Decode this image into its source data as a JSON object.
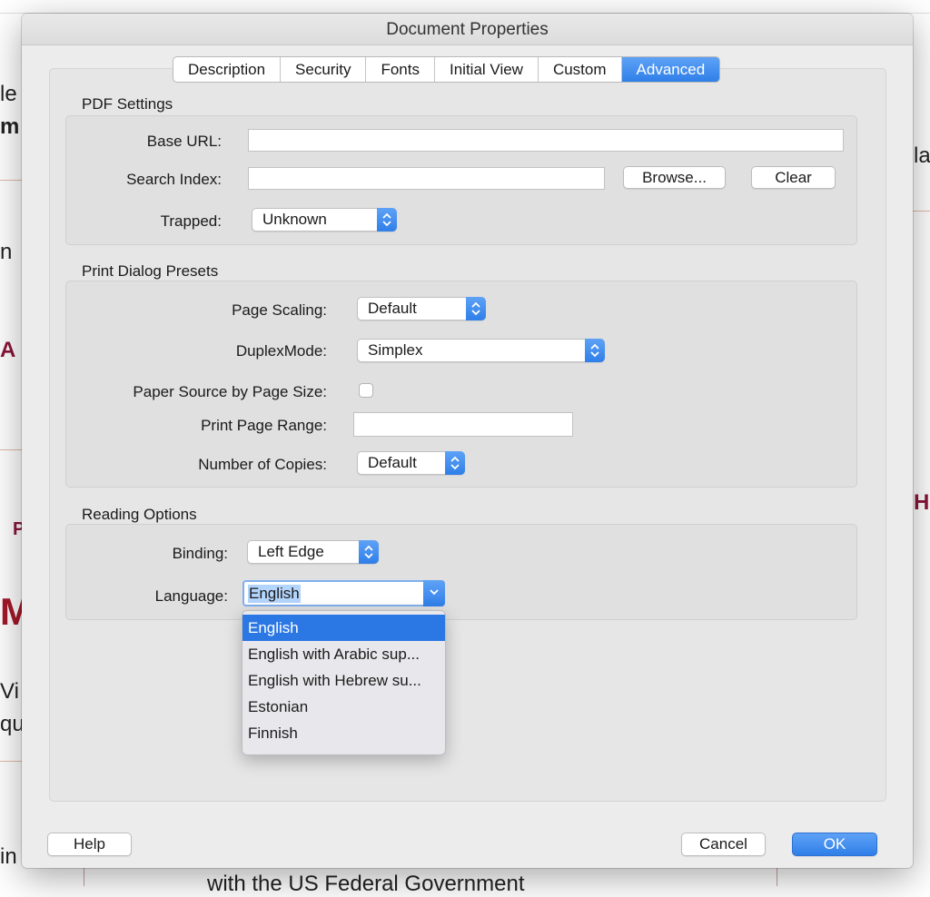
{
  "background": {
    "fragments": [
      "le",
      "m",
      "la",
      "n",
      "A",
      "H",
      "P",
      "Mi",
      "Vi",
      "qua",
      "in",
      "with the US Federal Government"
    ]
  },
  "dialog": {
    "title": "Document Properties",
    "tabs": [
      {
        "label": "Description",
        "active": false
      },
      {
        "label": "Security",
        "active": false
      },
      {
        "label": "Fonts",
        "active": false
      },
      {
        "label": "Initial View",
        "active": false
      },
      {
        "label": "Custom",
        "active": false
      },
      {
        "label": "Advanced",
        "active": true
      }
    ],
    "pdf_settings": {
      "title": "PDF Settings",
      "base_url_label": "Base URL:",
      "base_url_value": "",
      "search_index_label": "Search Index:",
      "search_index_value": "",
      "browse_label": "Browse...",
      "clear_label": "Clear",
      "trapped_label": "Trapped:",
      "trapped_value": "Unknown"
    },
    "print_presets": {
      "title": "Print Dialog Presets",
      "page_scaling_label": "Page Scaling:",
      "page_scaling_value": "Default",
      "duplex_label": "DuplexMode:",
      "duplex_value": "Simplex",
      "paper_source_label": "Paper Source by Page Size:",
      "paper_source_checked": false,
      "print_range_label": "Print Page Range:",
      "print_range_value": "",
      "copies_label": "Number of Copies:",
      "copies_value": "Default"
    },
    "reading_options": {
      "title": "Reading Options",
      "binding_label": "Binding:",
      "binding_value": "Left Edge",
      "language_label": "Language:",
      "language_value": "English",
      "language_options": [
        "English",
        "English with Arabic sup...",
        "English with Hebrew su...",
        "Estonian",
        "Finnish"
      ],
      "highlighted_index": 0
    },
    "footer": {
      "help_label": "Help",
      "cancel_label": "Cancel",
      "ok_label": "OK"
    }
  },
  "colors": {
    "accent": "#2f7fe8",
    "highlight": "#2b78e4",
    "selection": "#b3d4fc"
  }
}
